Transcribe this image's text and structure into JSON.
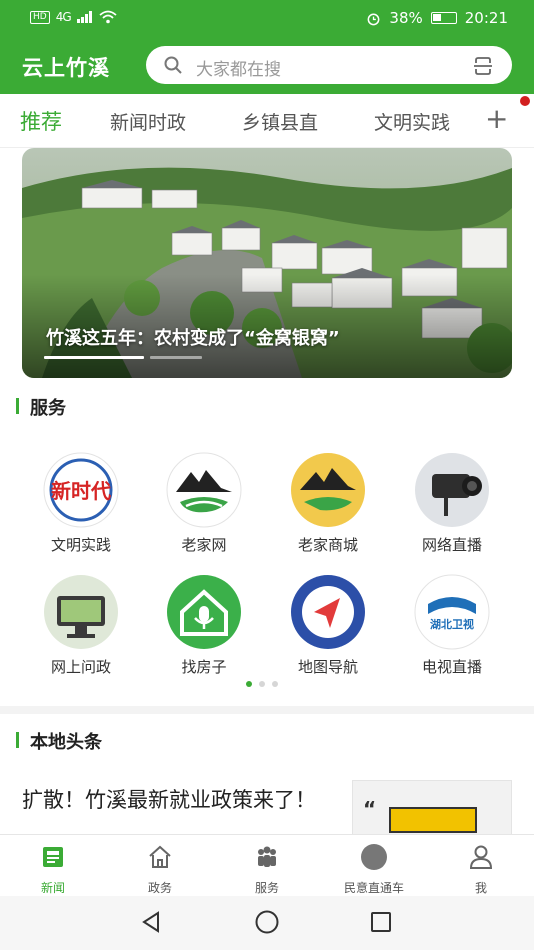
{
  "status_bar": {
    "network": "HD",
    "signal": "4G",
    "battery": "38%",
    "time": "20:21"
  },
  "header": {
    "app_title": "云上竹溪",
    "search_placeholder": "大家都在搜"
  },
  "tabs": [
    {
      "label": "推荐",
      "active": true
    },
    {
      "label": "新闻时政",
      "active": false
    },
    {
      "label": "乡镇县直",
      "active": false
    },
    {
      "label": "文明实践",
      "active": false
    }
  ],
  "tabs_add": "+",
  "banner": {
    "caption": "竹溪这五年：农村变成了“金窝银窝”"
  },
  "services": {
    "title": "服务",
    "items": [
      {
        "label": "文明实践",
        "icon": "wenming-logo-icon"
      },
      {
        "label": "老家网",
        "icon": "laojia-logo-icon"
      },
      {
        "label": "老家商城",
        "icon": "laojia-mall-icon"
      },
      {
        "label": "网络直播",
        "icon": "camera-icon"
      },
      {
        "label": "网上问政",
        "icon": "monitor-icon"
      },
      {
        "label": "找房子",
        "icon": "house-mic-icon"
      },
      {
        "label": "地图导航",
        "icon": "navigation-arrow-icon"
      },
      {
        "label": "电视直播",
        "icon": "hubei-tv-icon"
      }
    ],
    "hubei_tv_text": "湖北卫视",
    "wenming_text": "新时代"
  },
  "local_news": {
    "title": "本地头条",
    "headline": "扩散！竹溪最新就业政策来了！"
  },
  "bottom_nav": [
    {
      "label": "新闻",
      "icon": "news-icon",
      "active": true
    },
    {
      "label": "政务",
      "icon": "government-icon",
      "active": false
    },
    {
      "label": "服务",
      "icon": "service-people-icon",
      "active": false
    },
    {
      "label": "民意直通车",
      "icon": "public-opinion-icon",
      "active": false
    },
    {
      "label": "我",
      "icon": "profile-icon",
      "active": false
    }
  ],
  "colors": {
    "brand": "#3bab35",
    "badge": "#d21f1f"
  }
}
